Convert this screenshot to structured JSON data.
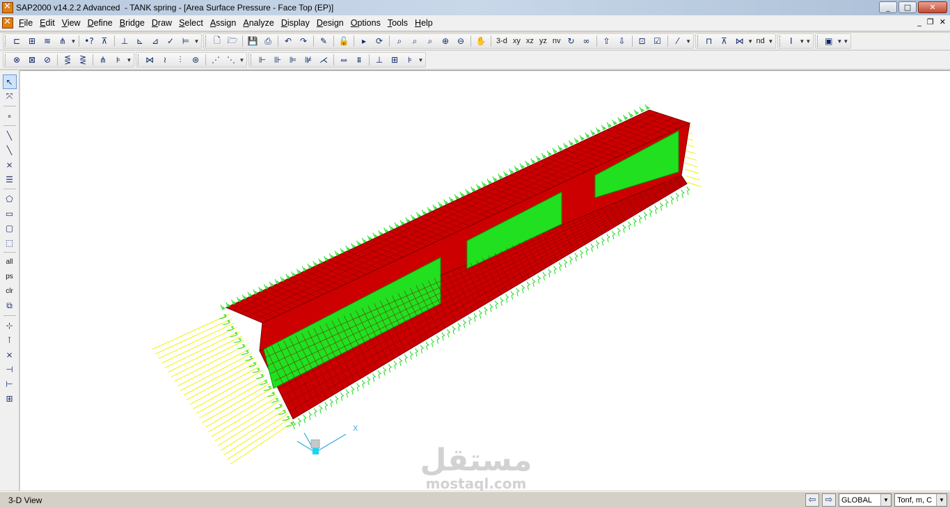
{
  "window": {
    "title": "SAP2000 v14.2.2 Advanced  - TANK spring - [Area Surface Pressure - Face Top (EP)]",
    "controls": [
      "_",
      "□",
      "✕"
    ]
  },
  "menu": {
    "items": [
      "File",
      "Edit",
      "View",
      "Define",
      "Bridge",
      "Draw",
      "Select",
      "Assign",
      "Analyze",
      "Display",
      "Design",
      "Options",
      "Tools",
      "Help"
    ],
    "mdi_controls": [
      "_",
      "❐",
      "✕"
    ]
  },
  "toolbar1": {
    "view_buttons": [
      "3-d",
      "xy",
      "xz",
      "yz",
      "nv"
    ],
    "nd_label": "nd"
  },
  "left_toolbar": {
    "text_buttons": [
      "all",
      "ps",
      "clr"
    ]
  },
  "canvas": {
    "axis_label": "X",
    "colors": {
      "shell": "#cc0000",
      "mesh": "#7a0000",
      "inner_walls": "#20e020",
      "springs": "#1fd81f",
      "end_springs": "#f2f200",
      "axes": "#2ba8e8"
    }
  },
  "watermark": {
    "arabic": "مستقل",
    "latin": "mostaql.com"
  },
  "statusbar": {
    "view_name": "3-D View",
    "coord_system": "GLOBAL",
    "units": "Tonf, m, C"
  }
}
